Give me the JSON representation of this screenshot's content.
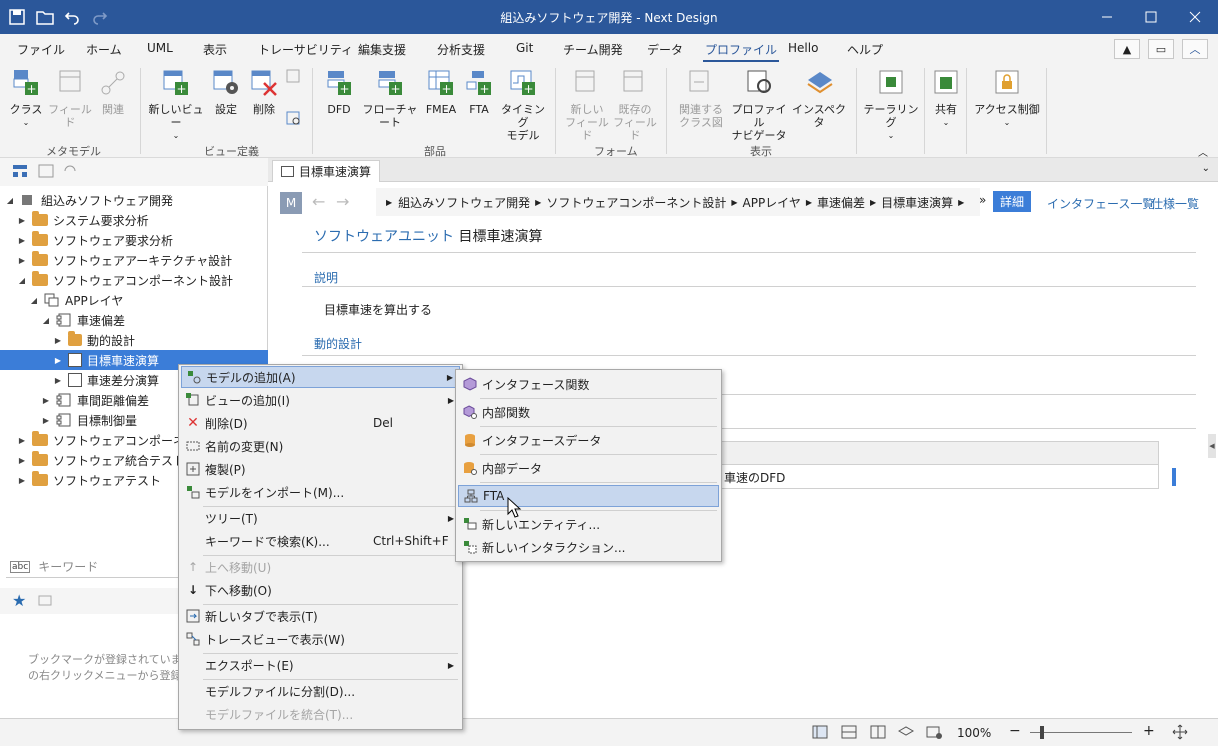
{
  "window": {
    "title": "組込みソフトウェア開発 - Next Design"
  },
  "menubar": {
    "items": [
      "ファイル",
      "ホーム",
      "UML",
      "表示",
      "トレーサビリティ",
      "編集支援",
      "分析支援",
      "Git",
      "チーム開発",
      "データ",
      "プロファイル",
      "Hello",
      "ヘルプ"
    ],
    "active": "プロファイル"
  },
  "ribbon": {
    "metamodel": {
      "group": "メタモデル",
      "class": "クラス",
      "field": "フィールド",
      "relation": "関連"
    },
    "viewdef": {
      "group": "ビュー定義",
      "newview": "新しいビュー",
      "settings": "設定",
      "delete": "削除"
    },
    "parts": {
      "group": "部品",
      "dfd": "DFD",
      "flowchart": "フローチャート",
      "fmea": "FMEA",
      "fta": "FTA",
      "timing1": "タイミング",
      "timing2": "モデル"
    },
    "form": {
      "group": "フォーム",
      "newfield1": "新しい",
      "newfield2": "フィールド",
      "existfield1": "既存の",
      "existfield2": "フィールド"
    },
    "display": {
      "group": "表示",
      "relclass1": "関連する",
      "relclass2": "クラス図",
      "profnav1": "プロファイル",
      "profnav2": "ナビゲータ",
      "inspector": "インスペクタ"
    },
    "tailoring": "テーラリング",
    "share": "共有",
    "access": "アクセス制御"
  },
  "tree": {
    "items": [
      {
        "label": "組込みソフトウェア開発",
        "level": 0
      },
      {
        "label": "システム要求分析",
        "level": 1
      },
      {
        "label": "ソフトウェア要求分析",
        "level": 1
      },
      {
        "label": "ソフトウェアアーキテクチャ設計",
        "level": 1
      },
      {
        "label": "ソフトウェアコンポーネント設計",
        "level": 1
      },
      {
        "label": "APPレイヤ",
        "level": 2
      },
      {
        "label": "車速偏差",
        "level": 3
      },
      {
        "label": "動的設計",
        "level": 4
      },
      {
        "label": "目標車速演算",
        "level": 4
      },
      {
        "label": "車速差分演算",
        "level": 4
      },
      {
        "label": "車間距離偏差",
        "level": 3
      },
      {
        "label": "目標制御量",
        "level": 3
      },
      {
        "label": "ソフトウェアコンポーネントテ",
        "level": 1
      },
      {
        "label": "ソフトウェア統合テスト",
        "level": 1
      },
      {
        "label": "ソフトウェアテスト",
        "level": 1
      }
    ]
  },
  "search": {
    "placeholder": "キーワード"
  },
  "bookmark": {
    "empty_text_1": "ブックマークが登録されていません",
    "empty_text_2": "の右クリックメニューから登録でき"
  },
  "editor": {
    "tab": "目標車速演算",
    "m_button": "M",
    "breadcrumb": [
      "組込みソフトウェア開発",
      "ソフトウェアコンポーネント設計",
      "APPレイヤ",
      "車速偏差",
      "目標車速演算"
    ],
    "views": {
      "detail": "詳細",
      "interface": "インタフェース一覧",
      "spec": "仕様一覧"
    },
    "unit_kind": "ソフトウェアユニット",
    "unit_name": "目標車速演算",
    "section_desc": "説明",
    "desc_text": "目標車速を算出する",
    "section_dynamic": "動的設計",
    "table_value": "車速のDFD"
  },
  "context_menu": {
    "items": [
      {
        "label": "モデルの追加(A)",
        "icon": "add-model-icon",
        "arrow": true
      },
      {
        "label": "ビューの追加(I)",
        "icon": "add-view-icon",
        "arrow": true
      },
      {
        "label": "削除(D)",
        "shortcut": "Del",
        "icon": "delete-x-icon"
      },
      {
        "label": "名前の変更(N)",
        "icon": "rename-icon"
      },
      {
        "label": "複製(P)",
        "icon": "duplicate-icon"
      },
      {
        "label": "モデルをインポート(M)...",
        "icon": "import-model-icon"
      },
      {
        "label": "ツリー(T)",
        "arrow": true
      },
      {
        "label": "キーワードで検索(K)...",
        "shortcut": "Ctrl+Shift+F"
      },
      {
        "label": "上へ移動(U)",
        "icon": "arrow-up-icon",
        "disabled": true
      },
      {
        "label": "下へ移動(O)",
        "icon": "arrow-down-icon"
      },
      {
        "label": "新しいタブで表示(T)",
        "icon": "new-tab-icon"
      },
      {
        "label": "トレースビューで表示(W)",
        "icon": "trace-view-icon"
      },
      {
        "label": "エクスポート(E)",
        "arrow": true
      },
      {
        "label": "モデルファイルに分割(D)..."
      },
      {
        "label": "モデルファイルを統合(T)...",
        "disabled": true
      }
    ]
  },
  "submenu": {
    "items": [
      {
        "label": "インタフェース関数",
        "icon": "interface-function-icon"
      },
      {
        "label": "内部関数",
        "icon": "internal-function-icon"
      },
      {
        "label": "インタフェースデータ",
        "icon": "interface-data-icon"
      },
      {
        "label": "内部データ",
        "icon": "internal-data-icon"
      },
      {
        "label": "FTA",
        "icon": "fta-icon",
        "hover": true
      },
      {
        "label": "新しいエンティティ...",
        "icon": "new-entity-icon"
      },
      {
        "label": "新しいインタラクション...",
        "icon": "new-interaction-icon"
      }
    ]
  },
  "status": {
    "zoom": "100%"
  },
  "colors": {
    "accent": "#2b579a",
    "selection": "#3b7dd8",
    "folder": "#e0a040",
    "link": "#2b6cb0"
  }
}
